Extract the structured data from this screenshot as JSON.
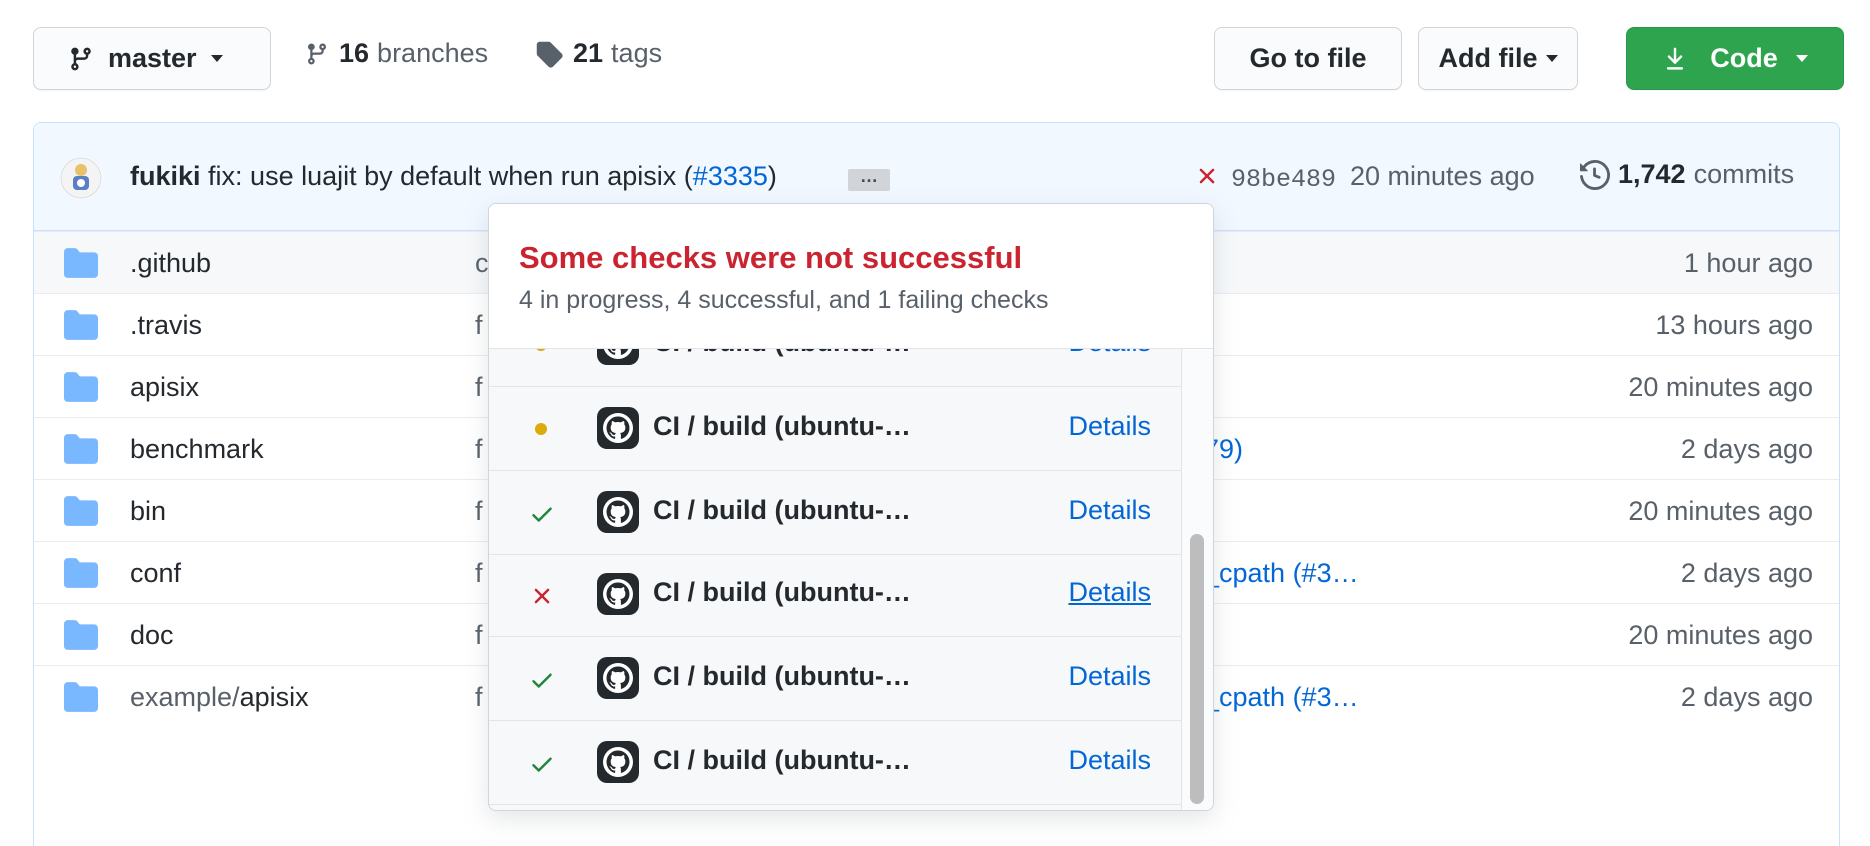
{
  "toolbar": {
    "branch_label": "master",
    "branches_count": "16",
    "branches_label": "branches",
    "tags_count": "21",
    "tags_label": "tags",
    "go_to_file_label": "Go to file",
    "add_file_label": "Add file",
    "code_label": "Code"
  },
  "commit": {
    "author": "fukiki",
    "message": "fix: use luajit by default when run apisix (",
    "pr": "#3335",
    "message_end": ")",
    "ellipsis": "…",
    "sha": "98be489",
    "time": "20 minutes ago",
    "commits_count": "1,742",
    "commits_label": "commits"
  },
  "files": [
    {
      "name": ".github",
      "msg": "c",
      "msg2": "",
      "time": "1 hour ago"
    },
    {
      "name": ".travis",
      "msg": "f",
      "msg2": "",
      "time": "13 hours ago"
    },
    {
      "name": "apisix",
      "msg": "f",
      "msg2": "",
      "time": "20 minutes ago"
    },
    {
      "name": "benchmark",
      "msg": "f",
      "msg2": "79)",
      "time": "2 days ago"
    },
    {
      "name": "bin",
      "msg": "f",
      "msg2": "",
      "time": "20 minutes ago"
    },
    {
      "name": "conf",
      "msg": "f",
      "msg2": "_cpath (#3…",
      "time": "2 days ago"
    },
    {
      "name": "doc",
      "msg": "f",
      "msg2": "",
      "time": "20 minutes ago"
    },
    {
      "name_prefix": "example/",
      "name": "apisix",
      "msg": "f",
      "msg2": "_cpath (#3…",
      "time": "2 days ago"
    }
  ],
  "checks_popover": {
    "title": "Some checks were not successful",
    "subtitle": "4 in progress, 4 successful, and 1 failing checks",
    "items": [
      {
        "status": "pending",
        "label": "CI / build (ubuntu-…",
        "details": "Details"
      },
      {
        "status": "pending",
        "label": "CI / build (ubuntu-…",
        "details": "Details"
      },
      {
        "status": "success",
        "label": "CI / build (ubuntu-…",
        "details": "Details"
      },
      {
        "status": "failure",
        "label": "CI / build (ubuntu-…",
        "details": "Details"
      },
      {
        "status": "success",
        "label": "CI / build (ubuntu-…",
        "details": "Details"
      },
      {
        "status": "success",
        "label": "CI / build (ubuntu-…",
        "details": "Details"
      }
    ]
  },
  "colors": {
    "code_button": "#2ea44f",
    "link": "#0366d6",
    "failure": "#cb2431",
    "success": "#22863a",
    "pending": "#dbab09",
    "folder": "#79b8ff"
  }
}
